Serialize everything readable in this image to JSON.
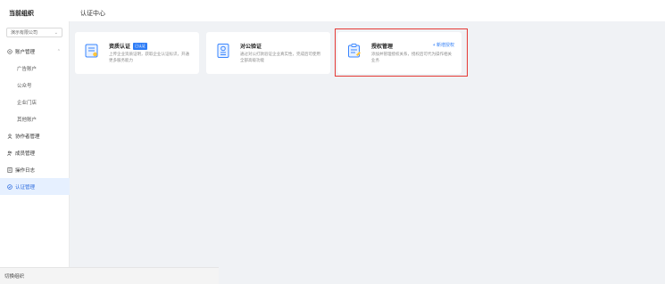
{
  "header": {
    "org_title": "当前组织",
    "page_title": "认证中心"
  },
  "sidebar": {
    "org_select_value": "演示有限公司",
    "items": [
      {
        "label": "账户管理",
        "icon": "account-icon",
        "type": "group"
      },
      {
        "label": "广告账户",
        "type": "sub"
      },
      {
        "label": "公众号",
        "type": "sub"
      },
      {
        "label": "企业门店",
        "type": "sub"
      },
      {
        "label": "其他账户",
        "type": "sub"
      },
      {
        "label": "协作者管理",
        "icon": "user-icon",
        "type": "top"
      },
      {
        "label": "成员管理",
        "icon": "team-icon",
        "type": "top"
      },
      {
        "label": "操作日志",
        "icon": "log-icon",
        "type": "top"
      },
      {
        "label": "认证管理",
        "icon": "shield-icon",
        "type": "top",
        "active": true
      }
    ],
    "footer_label": "切换组织"
  },
  "cards": [
    {
      "title": "资质认证",
      "badge": "已认证",
      "desc": "上传企业资质证明，获取企业认证标识，开通更多服务能力",
      "icon": "certificate-icon"
    },
    {
      "title": "对公验证",
      "desc": "通过对公打款验证企业真实性，完成后可使用全部高级功能",
      "icon": "bank-verify-icon"
    },
    {
      "title": "授权管理",
      "action": "+ 新增授权",
      "desc": "添加并管理授权关系，授权后可代为操作相关业务",
      "icon": "authorize-icon"
    }
  ],
  "colors": {
    "accent": "#2d7cf6",
    "highlight": "#e53935",
    "active_bg": "#e6f0ff"
  }
}
